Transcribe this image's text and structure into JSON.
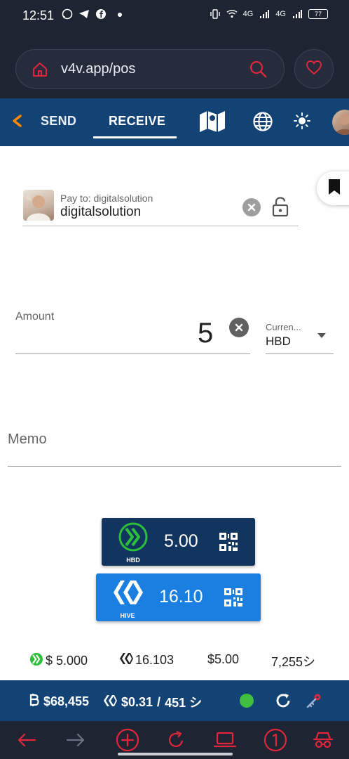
{
  "status_bar": {
    "time": "12:51",
    "net1": "4G",
    "net2": "4G",
    "battery": "77"
  },
  "browser": {
    "url": "v4v.app/pos"
  },
  "nav": {
    "send_label": "SEND",
    "receive_label": "RECEIVE"
  },
  "payto": {
    "label": "Pay to: digitalsolution",
    "value": "digitalsolution"
  },
  "amount": {
    "label": "Amount",
    "value": "5"
  },
  "currency": {
    "label": "Curren...",
    "value": "HBD"
  },
  "memo": {
    "label": "Memo"
  },
  "payment_buttons": [
    {
      "coin": "HBD",
      "amount": "5.00"
    },
    {
      "coin": "HIVE",
      "amount": "16.10"
    }
  ],
  "totals": {
    "hbd": "$ 5.000",
    "hive": "16.103",
    "usd": "$5.00",
    "sats": "7,255シ"
  },
  "footer": {
    "btc_price": "$68,455",
    "hive_price": "$0.31",
    "separator": "/",
    "sats_per_hive": "451 シ"
  },
  "colors": {
    "nav_bg": "#134274",
    "accent_orange": "#ff8a00",
    "hbd_button": "#12355f",
    "hive_button": "#1a7fe0",
    "browser_red": "#e0263a",
    "status_green": "#3fbe3f"
  }
}
